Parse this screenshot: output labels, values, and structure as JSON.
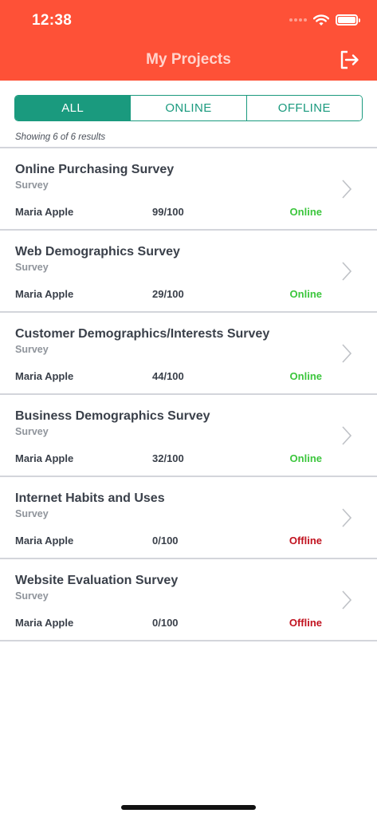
{
  "status_bar": {
    "time": "12:38"
  },
  "header": {
    "title": "My Projects",
    "logout_icon": "logout-icon"
  },
  "colors": {
    "header": "#fe5137",
    "accent": "#1a9a7e",
    "online": "#3cc63d",
    "offline": "#c1121f"
  },
  "filter": {
    "tabs": [
      {
        "label": "ALL",
        "active": true
      },
      {
        "label": "ONLINE",
        "active": false
      },
      {
        "label": "OFFLINE",
        "active": false
      }
    ]
  },
  "results_text": "Showing 6 of 6 results",
  "projects": [
    {
      "title": "Online Purchasing Survey",
      "type": "Survey",
      "owner": "Maria Apple",
      "progress": "99/100",
      "status": "Online"
    },
    {
      "title": "Web Demographics Survey",
      "type": "Survey",
      "owner": "Maria Apple",
      "progress": "29/100",
      "status": "Online"
    },
    {
      "title": "Customer Demographics/Interests Survey",
      "type": "Survey",
      "owner": "Maria Apple",
      "progress": "44/100",
      "status": "Online"
    },
    {
      "title": "Business Demographics Survey",
      "type": "Survey",
      "owner": "Maria Apple",
      "progress": "32/100",
      "status": "Online"
    },
    {
      "title": "Internet Habits and Uses",
      "type": "Survey",
      "owner": "Maria Apple",
      "progress": "0/100",
      "status": "Offline"
    },
    {
      "title": "Website Evaluation Survey",
      "type": "Survey",
      "owner": "Maria Apple",
      "progress": "0/100",
      "status": "Offline"
    }
  ]
}
